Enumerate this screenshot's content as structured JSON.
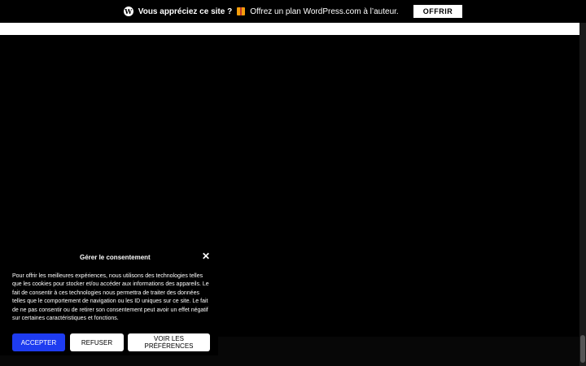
{
  "topbar": {
    "wp_icon_name": "wordpress-icon",
    "question": "Vous appréciez ce site ?",
    "gift_icon_name": "gift-icon",
    "offer_text": "Offrez un plan WordPress.com à l’auteur.",
    "button_label": "OFFRIR"
  },
  "consent": {
    "title": "Gérer le consentement",
    "close_icon": "close-icon",
    "body": "Pour offrir les meilleures expériences, nous utilisons des technologies telles que les cookies pour stocker et/ou accéder aux informations des appareils. Le fait de consentir à ces technologies nous permettra de traiter des données telles que le comportement de navigation ou les ID uniques sur ce site. Le fait de ne pas consentir ou de retirer son consentement peut avoir un effet négatif sur certaines caractéristiques et fonctions.",
    "accept_label": "ACCEPTER",
    "refuse_label": "REFUSER",
    "prefs_label": "VOIR LES PRÉFÉRENCES"
  },
  "colors": {
    "accent": "#1e3cf0",
    "background": "#000000"
  }
}
